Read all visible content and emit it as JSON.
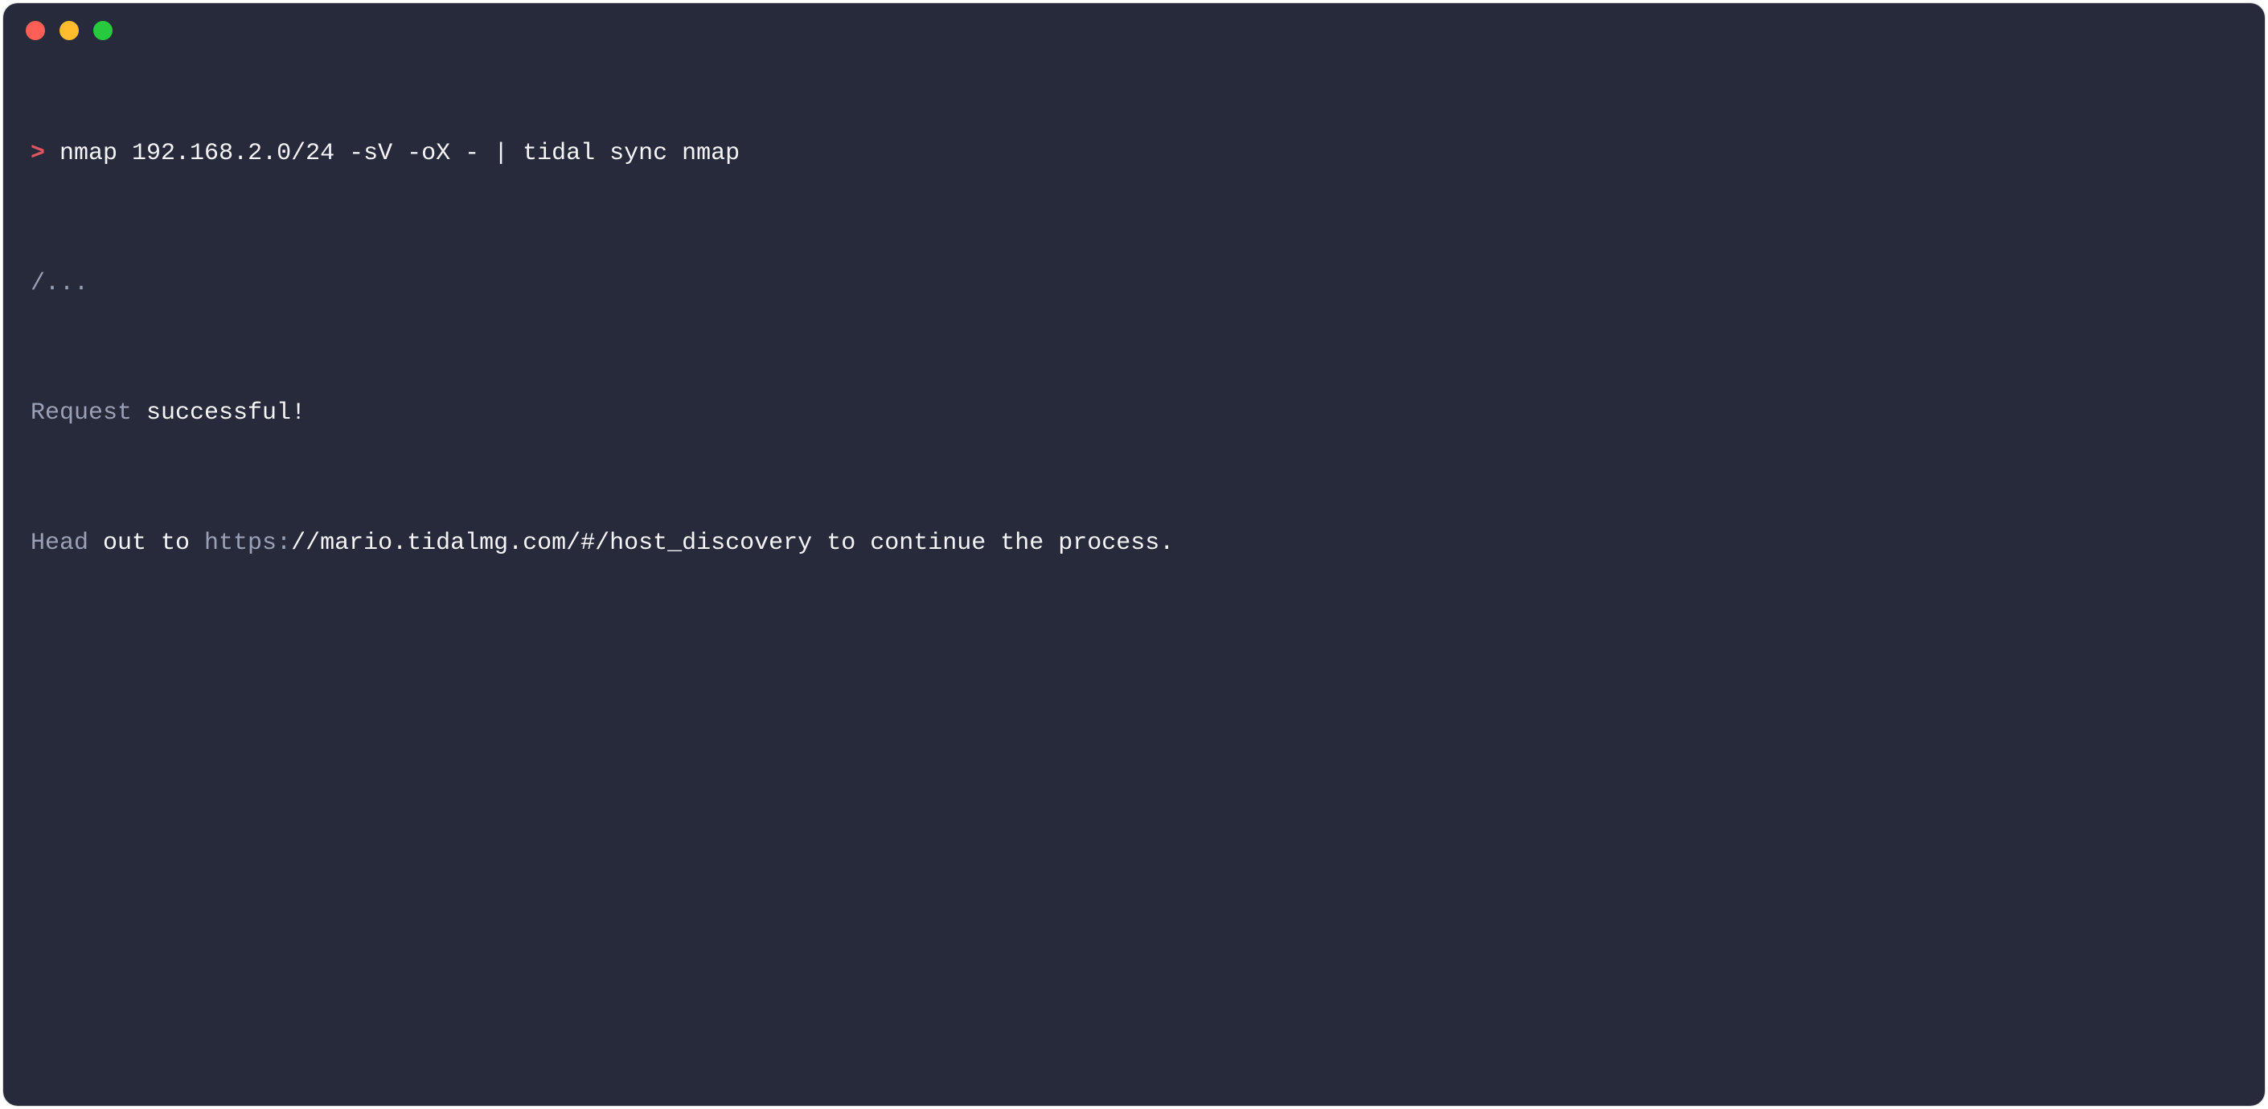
{
  "prompt": {
    "symbol": ">",
    "command": "nmap 192.168.2.0/24 -sV -oX - | tidal sync nmap"
  },
  "output": {
    "ellipsis": "/...",
    "request_word": "Request",
    "successful_rest": " successful!",
    "head_word": "Head",
    "out_to": " out to ",
    "url_scheme": "https:",
    "url_rest": "//mario.tidalmg.com/#/host_discovery",
    "continue_rest": " to continue the process."
  }
}
